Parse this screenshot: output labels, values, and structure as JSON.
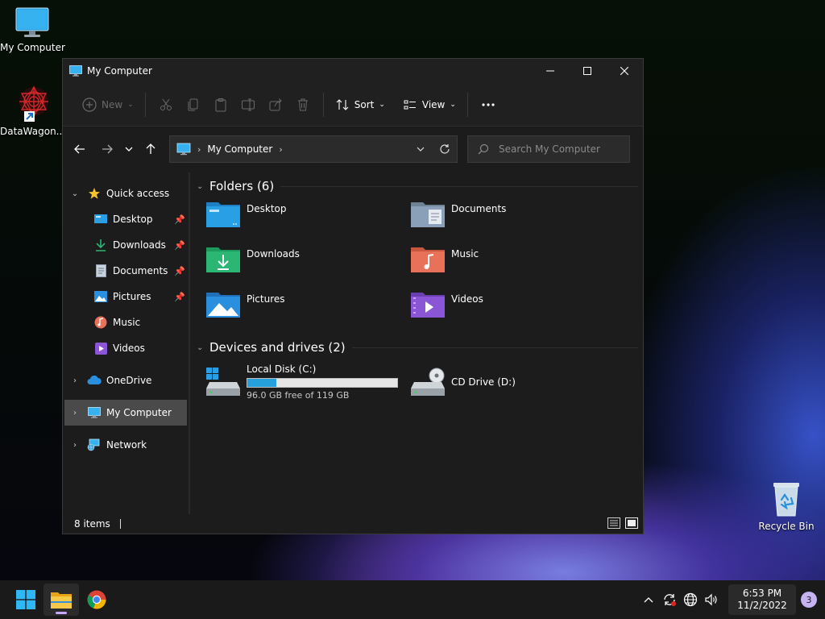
{
  "desktop": {
    "icons": [
      {
        "label": "My Computer"
      },
      {
        "label": "DataWagon..."
      },
      {
        "label": "Recycle Bin"
      }
    ]
  },
  "window": {
    "title": "My Computer",
    "commands": {
      "new_label": "New",
      "sort_label": "Sort",
      "view_label": "View"
    },
    "address": {
      "crumb": "My Computer"
    },
    "search": {
      "placeholder": "Search My Computer"
    },
    "nav": {
      "quick_access": "Quick access",
      "items": [
        {
          "label": "Desktop"
        },
        {
          "label": "Downloads"
        },
        {
          "label": "Documents"
        },
        {
          "label": "Pictures"
        },
        {
          "label": "Music"
        },
        {
          "label": "Videos"
        }
      ],
      "onedrive": "OneDrive",
      "my_computer": "My Computer",
      "network": "Network"
    },
    "folders_header": "Folders (6)",
    "folders": [
      {
        "name": "Desktop",
        "color": "#29a0e6"
      },
      {
        "name": "Documents",
        "color": "#8aa0b8"
      },
      {
        "name": "Downloads",
        "color": "#2bb673"
      },
      {
        "name": "Music",
        "color": "#e8715a"
      },
      {
        "name": "Pictures",
        "color": "#2b8fe0"
      },
      {
        "name": "Videos",
        "color": "#8a55d6"
      }
    ],
    "drives_header": "Devices and drives (2)",
    "drives": [
      {
        "name": "Local Disk (C:)",
        "free_text": "96.0 GB free of 119 GB",
        "used_fraction": 0.193
      },
      {
        "name": "CD Drive (D:)"
      }
    ],
    "status": {
      "items_text": "8 items"
    }
  },
  "taskbar": {
    "clock_time": "6:53 PM",
    "clock_date": "11/2/2022",
    "notification_count": "3"
  }
}
